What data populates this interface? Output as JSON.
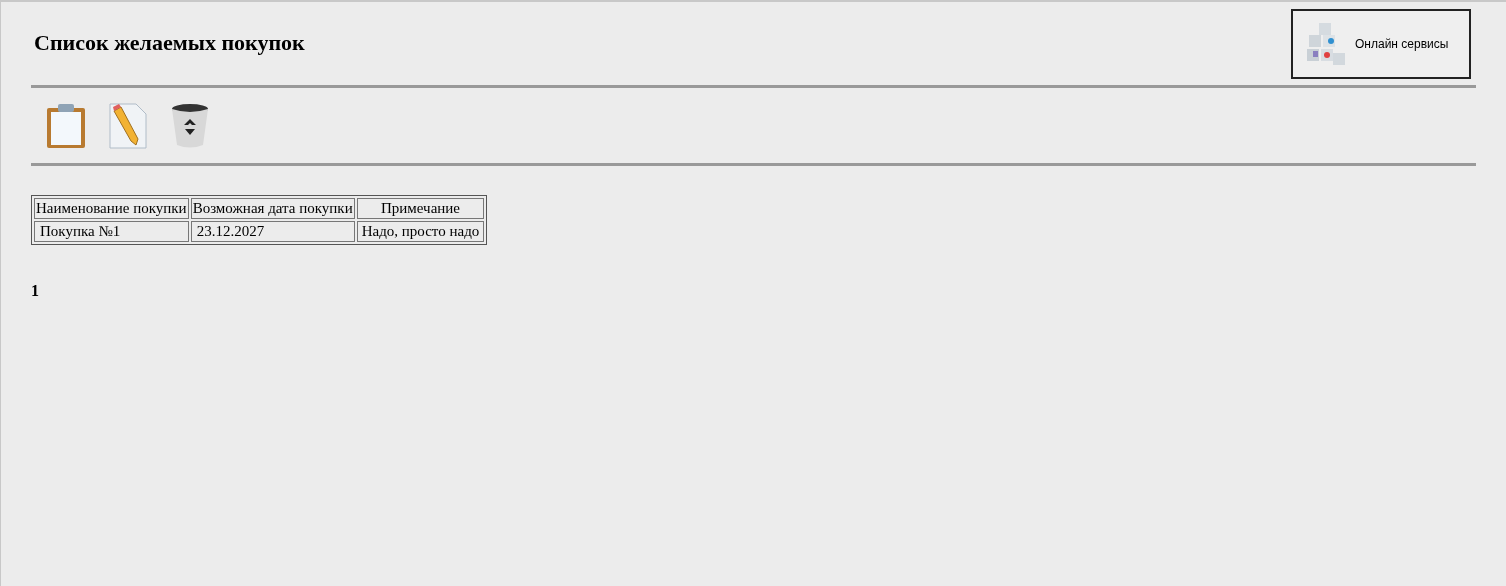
{
  "title": "Список желаемых покупок",
  "services_button": {
    "label": "Онлайн сервисы"
  },
  "table": {
    "columns": [
      "Наименование покупки",
      "Возможная дата покупки",
      "Примечание"
    ],
    "rows": [
      [
        "Покупка №1",
        "23.12.2027",
        "Надо, просто надо"
      ]
    ]
  },
  "pagination": [
    "1"
  ]
}
